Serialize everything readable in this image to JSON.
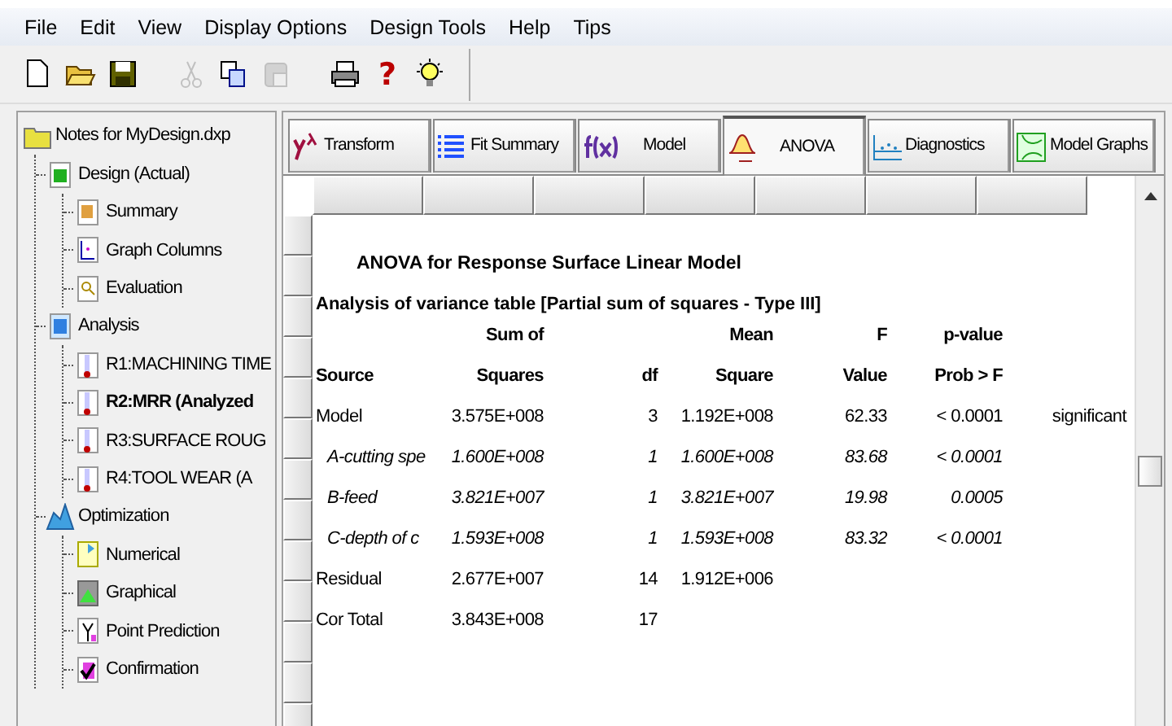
{
  "menu": [
    "File",
    "Edit",
    "View",
    "Display Options",
    "Design Tools",
    "Help",
    "Tips"
  ],
  "toolbar": [
    {
      "kind": "new"
    },
    {
      "kind": "open"
    },
    {
      "kind": "save"
    },
    {
      "kind": "gap"
    },
    {
      "kind": "cut",
      "disabled": true
    },
    {
      "kind": "copy",
      "disabled": false
    },
    {
      "kind": "paste",
      "disabled": true
    },
    {
      "kind": "gap"
    },
    {
      "kind": "print"
    },
    {
      "kind": "help",
      "glyph": "?"
    },
    {
      "kind": "tip"
    }
  ],
  "tree": {
    "label": "Notes for MyDesign.dxp",
    "children": [
      {
        "label": "Design (Actual)",
        "kind": "design",
        "selected": false,
        "children": [
          {
            "label": "Summary",
            "kind": "summary",
            "selected": false
          },
          {
            "label": "Graph Columns",
            "kind": "graph",
            "selected": false
          },
          {
            "label": "Evaluation",
            "kind": "eval",
            "selected": false
          }
        ]
      },
      {
        "label": "Analysis",
        "kind": "analysis",
        "selected": false,
        "children": [
          {
            "label": "R1:MACHINING TIME",
            "kind": "response",
            "selected": false
          },
          {
            "label": "R2:MRR (Analyzed",
            "kind": "response",
            "selected": true
          },
          {
            "label": "R3:SURFACE ROUG",
            "kind": "response",
            "selected": false
          },
          {
            "label": "R4:TOOL WEAR  (A",
            "kind": "response",
            "selected": false
          }
        ]
      },
      {
        "label": "Optimization",
        "kind": "optim",
        "selected": false,
        "children": [
          {
            "label": "Numerical",
            "kind": "numerical",
            "selected": false
          },
          {
            "label": "Graphical",
            "kind": "graphical",
            "selected": false
          },
          {
            "label": "Point Prediction",
            "kind": "point",
            "selected": false
          },
          {
            "label": "Confirmation",
            "kind": "confirm",
            "selected": false
          }
        ]
      }
    ]
  },
  "tabs": [
    {
      "label": "Transform",
      "kind": "transform",
      "selected": false
    },
    {
      "label": "Fit Summary",
      "kind": "fit",
      "selected": false
    },
    {
      "label": "Model",
      "kind": "model",
      "selected": false
    },
    {
      "label": "ANOVA",
      "kind": "anova",
      "selected": true
    },
    {
      "label": "Diagnostics",
      "kind": "diag",
      "selected": false
    },
    {
      "label": "Model Graphs",
      "kind": "graphs",
      "selected": false
    }
  ],
  "report": {
    "title": "ANOVA for Response Surface Linear Model",
    "subtitle": "Analysis of variance table [Partial sum of squares - Type III]",
    "header_rows": [
      [
        "",
        "Sum of",
        "",
        "Mean",
        "F",
        "p-value",
        ""
      ],
      [
        "Source",
        "Squares",
        "df",
        "Square",
        "Value",
        "Prob > F",
        ""
      ]
    ],
    "rows": [
      {
        "kind": "total",
        "cells": [
          "Model",
          "3.575E+008",
          "3",
          "1.192E+008",
          "62.33",
          "< 0.0001",
          "significant"
        ]
      },
      {
        "kind": "term",
        "cells": [
          "A-cutting spe",
          "1.600E+008",
          "1",
          "1.600E+008",
          "83.68",
          "< 0.0001",
          ""
        ]
      },
      {
        "kind": "term",
        "cells": [
          "B-feed",
          "3.821E+007",
          "1",
          "3.821E+007",
          "19.98",
          "0.0005",
          ""
        ]
      },
      {
        "kind": "term",
        "cells": [
          "C-depth of c",
          "1.593E+008",
          "1",
          "1.593E+008",
          "83.32",
          "< 0.0001",
          ""
        ]
      },
      {
        "kind": "total",
        "cells": [
          "Residual",
          "2.677E+007",
          "14",
          "1.912E+006",
          "",
          "",
          ""
        ]
      },
      {
        "kind": "total",
        "cells": [
          "Cor Total",
          "3.843E+008",
          "17",
          "",
          "",
          "",
          ""
        ]
      }
    ]
  }
}
